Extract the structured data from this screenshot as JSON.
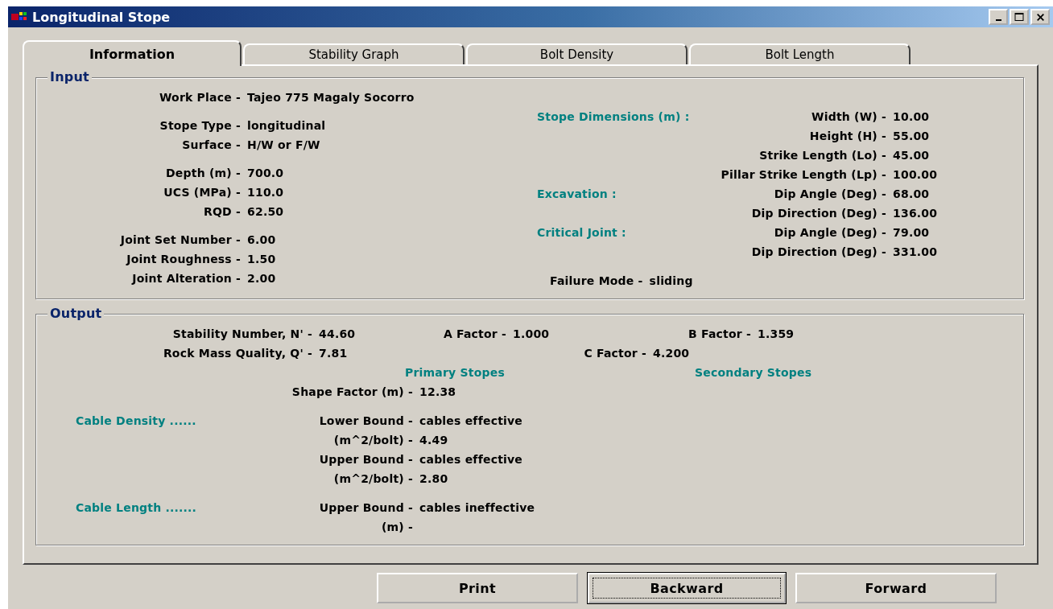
{
  "window": {
    "title": "Longitudinal Stope"
  },
  "tabs": [
    {
      "label": "Information",
      "selected": true
    },
    {
      "label": "Stability Graph",
      "selected": false
    },
    {
      "label": "Bolt Density",
      "selected": false
    },
    {
      "label": "Bolt Length",
      "selected": false
    }
  ],
  "input": {
    "title": "Input",
    "left_groups": [
      [
        {
          "label": "Work Place -",
          "value": "Tajeo 775 Magaly Socorro"
        }
      ],
      [
        {
          "label": "Stope Type -",
          "value": "longitudinal"
        },
        {
          "label": "Surface -",
          "value": "H/W or F/W"
        }
      ],
      [
        {
          "label": "Depth (m) -",
          "value": "700.0"
        },
        {
          "label": "UCS (MPa) -",
          "value": "110.0"
        },
        {
          "label": "RQD -",
          "value": "62.50"
        }
      ],
      [
        {
          "label": "Joint Set Number -",
          "value": "6.00"
        },
        {
          "label": "Joint Roughness -",
          "value": "1.50"
        },
        {
          "label": "Joint Alteration -",
          "value": "2.00"
        }
      ]
    ],
    "right_rows": [
      {
        "section": "Stope Dimensions (m) :",
        "label": "Width (W) -",
        "value": "10.00"
      },
      {
        "label": "Height (H) -",
        "value": "55.00"
      },
      {
        "label": "Strike Length (Lo) -",
        "value": "45.00"
      },
      {
        "label": "Pillar Strike Length (Lp) -",
        "value": "100.00"
      },
      {
        "section": "Excavation :",
        "label": "Dip Angle (Deg) -",
        "value": "68.00"
      },
      {
        "label": "Dip Direction (Deg) -",
        "value": "136.00"
      },
      {
        "section": "Critical Joint :",
        "label": "Dip Angle (Deg) -",
        "value": "79.00"
      },
      {
        "label": "Dip Direction (Deg) -",
        "value": "331.00"
      }
    ],
    "failure_mode": {
      "label": "Failure Mode -",
      "value": "sliding"
    }
  },
  "output": {
    "title": "Output",
    "factor_rows": [
      [
        {
          "label": "Stability Number, N' -",
          "value": "44.60"
        },
        {
          "label": "A Factor -",
          "value": "1.000"
        },
        {
          "label": "B Factor -",
          "value": "1.359"
        }
      ],
      [
        {
          "label": "Rock Mass Quality, Q' -",
          "value": "7.81"
        },
        {
          "label": "C Factor -",
          "value": "4.200"
        }
      ]
    ],
    "stope_headings": [
      "Primary Stopes",
      "Secondary Stopes"
    ],
    "shape_factor": {
      "label": "Shape Factor (m) -",
      "value": "12.38"
    },
    "sections": [
      {
        "heading": "Cable Density ......",
        "rows": [
          {
            "label": "Lower Bound -",
            "value": "cables effective"
          },
          {
            "label": "(m^2/bolt) -",
            "value": "4.49"
          },
          {
            "label": "Upper Bound -",
            "value": "cables effective"
          },
          {
            "label": "(m^2/bolt) -",
            "value": "2.80"
          }
        ]
      },
      {
        "heading": "Cable Length .......",
        "rows": [
          {
            "label": "Upper Bound -",
            "value": "cables ineffective"
          },
          {
            "label": "(m) -"
          }
        ]
      }
    ]
  },
  "buttons": [
    {
      "label": "Print",
      "focused": false
    },
    {
      "label": "Backward",
      "focused": true
    },
    {
      "label": "Forward",
      "focused": false
    }
  ]
}
